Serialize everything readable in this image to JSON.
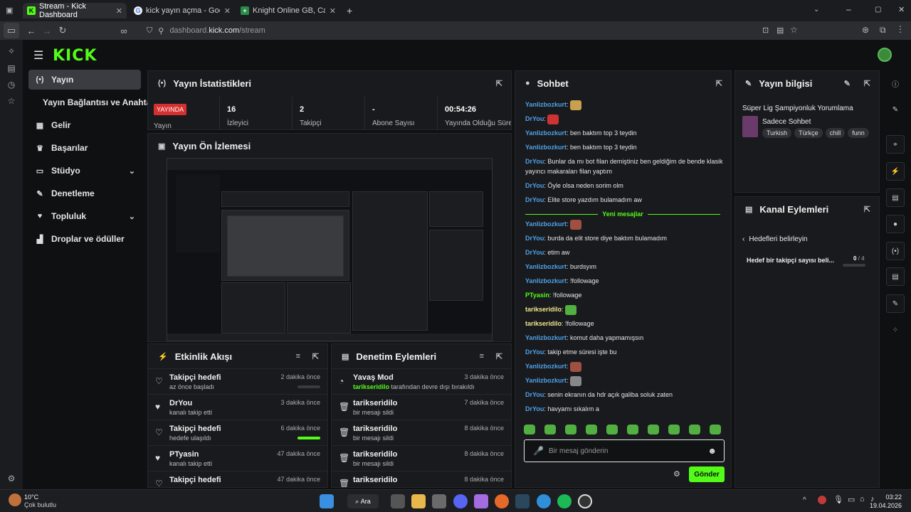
{
  "browser": {
    "tabs": [
      {
        "title": "Stream - Kick Dashboard",
        "fav": "K"
      },
      {
        "title": "kick yayın açma - Google'da Ara",
        "fav": "G"
      },
      {
        "title": "Knight Online GB, Cash ve İtem",
        "fav": "+"
      }
    ],
    "new_tab": "+",
    "url_prefix": "dashboard.",
    "url_host": "kick.com",
    "url_path": "/stream"
  },
  "logo": "KICK",
  "sidebar": {
    "items": [
      {
        "label": "Yayın",
        "icon": "broadcast-icon"
      },
      {
        "label": "Yayın Bağlantısı ve Anahtarı",
        "icon": ""
      },
      {
        "label": "Gelir",
        "icon": "revenue-icon"
      },
      {
        "label": "Başarılar",
        "icon": "trophy-icon"
      },
      {
        "label": "Stüdyo",
        "icon": "studio-icon"
      },
      {
        "label": "Denetleme",
        "icon": "wrench-icon"
      },
      {
        "label": "Topluluk",
        "icon": "community-icon"
      },
      {
        "label": "Droplar ve ödüller",
        "icon": "gift-icon"
      }
    ]
  },
  "stats": {
    "title": "Yayın İstatistikleri",
    "live_badge": "YAYINDA",
    "live_label": "Yayın",
    "items": [
      {
        "value": "16",
        "label": "İzleyici"
      },
      {
        "value": "2",
        "label": "Takipçi"
      },
      {
        "value": "-",
        "label": "Abone Sayısı"
      },
      {
        "value": "00:54:26",
        "label": "Yayında Olduğu Süre"
      }
    ]
  },
  "preview": {
    "title": "Yayın Ön İzlemesi"
  },
  "activity": {
    "title": "Etkinlik Akışı",
    "rows": [
      {
        "title": "Takipçi hedefi",
        "sub": "az önce başladı",
        "time": "2 dakika önce",
        "progress": 0
      },
      {
        "title": "DrYou",
        "sub": "kanalı takip etti",
        "time": "3 dakika önce"
      },
      {
        "title": "Takipçi hedefi",
        "sub": "hedefe ulaşıldı",
        "time": "6 dakika önce",
        "progress": 1
      },
      {
        "title": "PTyasin",
        "sub": "kanalı takip etti",
        "time": "47 dakika önce"
      },
      {
        "title": "Takipçi hedefi",
        "sub": "",
        "time": "47 dakika önce"
      }
    ]
  },
  "moderation": {
    "title": "Denetim Eylemleri",
    "rows": [
      {
        "title": "Yavaş Mod",
        "user": "tarikseridilo",
        "sub": "tarafından devre dışı bırakıldı",
        "time": "3 dakika önce"
      },
      {
        "title": "tarikseridilo",
        "user": "",
        "sub": "bir mesajı sildi",
        "time": "7 dakika önce"
      },
      {
        "title": "tarikseridilo",
        "user": "",
        "sub": "bir mesajı sildi",
        "time": "8 dakika önce"
      },
      {
        "title": "tarikseridilo",
        "user": "",
        "sub": "bir mesajı sildi",
        "time": "8 dakika önce"
      },
      {
        "title": "tarikseridilo",
        "user": "",
        "sub": "",
        "time": "8 dakika önce"
      }
    ]
  },
  "chat": {
    "title": "Sohbet",
    "new_messages": "Yeni mesajlar",
    "messages": [
      {
        "user": "Yanlizbozkurt",
        "text": "",
        "color": "b",
        "emote": "#c8a050"
      },
      {
        "user": "DrYou",
        "text": "",
        "color": "b",
        "emote": "#cc3333"
      },
      {
        "user": "Yanlizbozkurt",
        "text": "ben baktım top 3 teydin",
        "color": "b"
      },
      {
        "user": "Yanlizbozkurt",
        "text": "ben baktım top 3 teydin",
        "color": "b"
      },
      {
        "user": "DrYou",
        "text": "Bunlar da mı bot filan demiştiniz ben geldiğim de bende klasik yayıncı makaraları filan yaptım",
        "color": "b"
      },
      {
        "user": "DrYou",
        "text": "Öyle olsa neden sorim olm",
        "color": "b"
      },
      {
        "user": "DrYou",
        "text": "Elite store yazdım bulamadım aw",
        "color": "b"
      },
      {
        "user": "Yanlizbozkurt",
        "text": "",
        "color": "b",
        "emote": "#a05040"
      },
      {
        "user": "DrYou",
        "text": "burda da elit store diye baktım bulamadım",
        "color": "b"
      },
      {
        "user": "DrYou",
        "text": "etim aw",
        "color": "b"
      },
      {
        "user": "Yanlizbozkurt",
        "text": "burdsyım",
        "color": "b"
      },
      {
        "user": "Yanlizbozkurt",
        "text": "!followage",
        "color": "b"
      },
      {
        "user": "PTyasin",
        "text": "!followage",
        "color": "g"
      },
      {
        "user": "tarikseridilo",
        "text": "",
        "color": "y",
        "emote": "#52b043"
      },
      {
        "user": "tarikseridilo",
        "text": "!followage",
        "color": "y"
      },
      {
        "user": "Yanlizbozkurt",
        "text": "komut daha yapmamışsın",
        "color": "b"
      },
      {
        "user": "DrYou",
        "text": "takip etme süresi işte bu",
        "color": "b"
      },
      {
        "user": "Yanlizbozkurt",
        "text": "",
        "color": "b",
        "emote": "#a05040"
      },
      {
        "user": "Yanlizbozkurt",
        "text": "",
        "color": "b",
        "emote": "#888888"
      },
      {
        "user": "DrYou",
        "text": "senin ekranın da hdr açık galiba soluk zaten",
        "color": "b"
      },
      {
        "user": "DrYou",
        "text": "havyamı sıkalım a",
        "color": "b"
      }
    ],
    "input_placeholder": "Bir mesaj gönderin",
    "send_label": "Gönder"
  },
  "stream_info": {
    "title": "Yayın bilgisi",
    "stream_title": "Süper Lig Şampiyonluk Yorumlama",
    "category": "Sadece Sohbet",
    "tags": [
      "Turkish",
      "Türkçe",
      "chill",
      "funn"
    ]
  },
  "channel_actions": {
    "title": "Kanal Eylemleri",
    "back_label": "Hedefleri belirleyin",
    "goal_label": "Hedef bir takipçi sayısı beli...",
    "goal_current": "0",
    "goal_total": "/ 4"
  },
  "taskbar": {
    "weather_temp": "10°C",
    "weather_text": "Çok bulutlu",
    "search_label": "Ara",
    "time": "03:22",
    "date": "19.04.2026"
  },
  "colors": {
    "accent": "#53fc18",
    "live": "#d62f2f"
  }
}
